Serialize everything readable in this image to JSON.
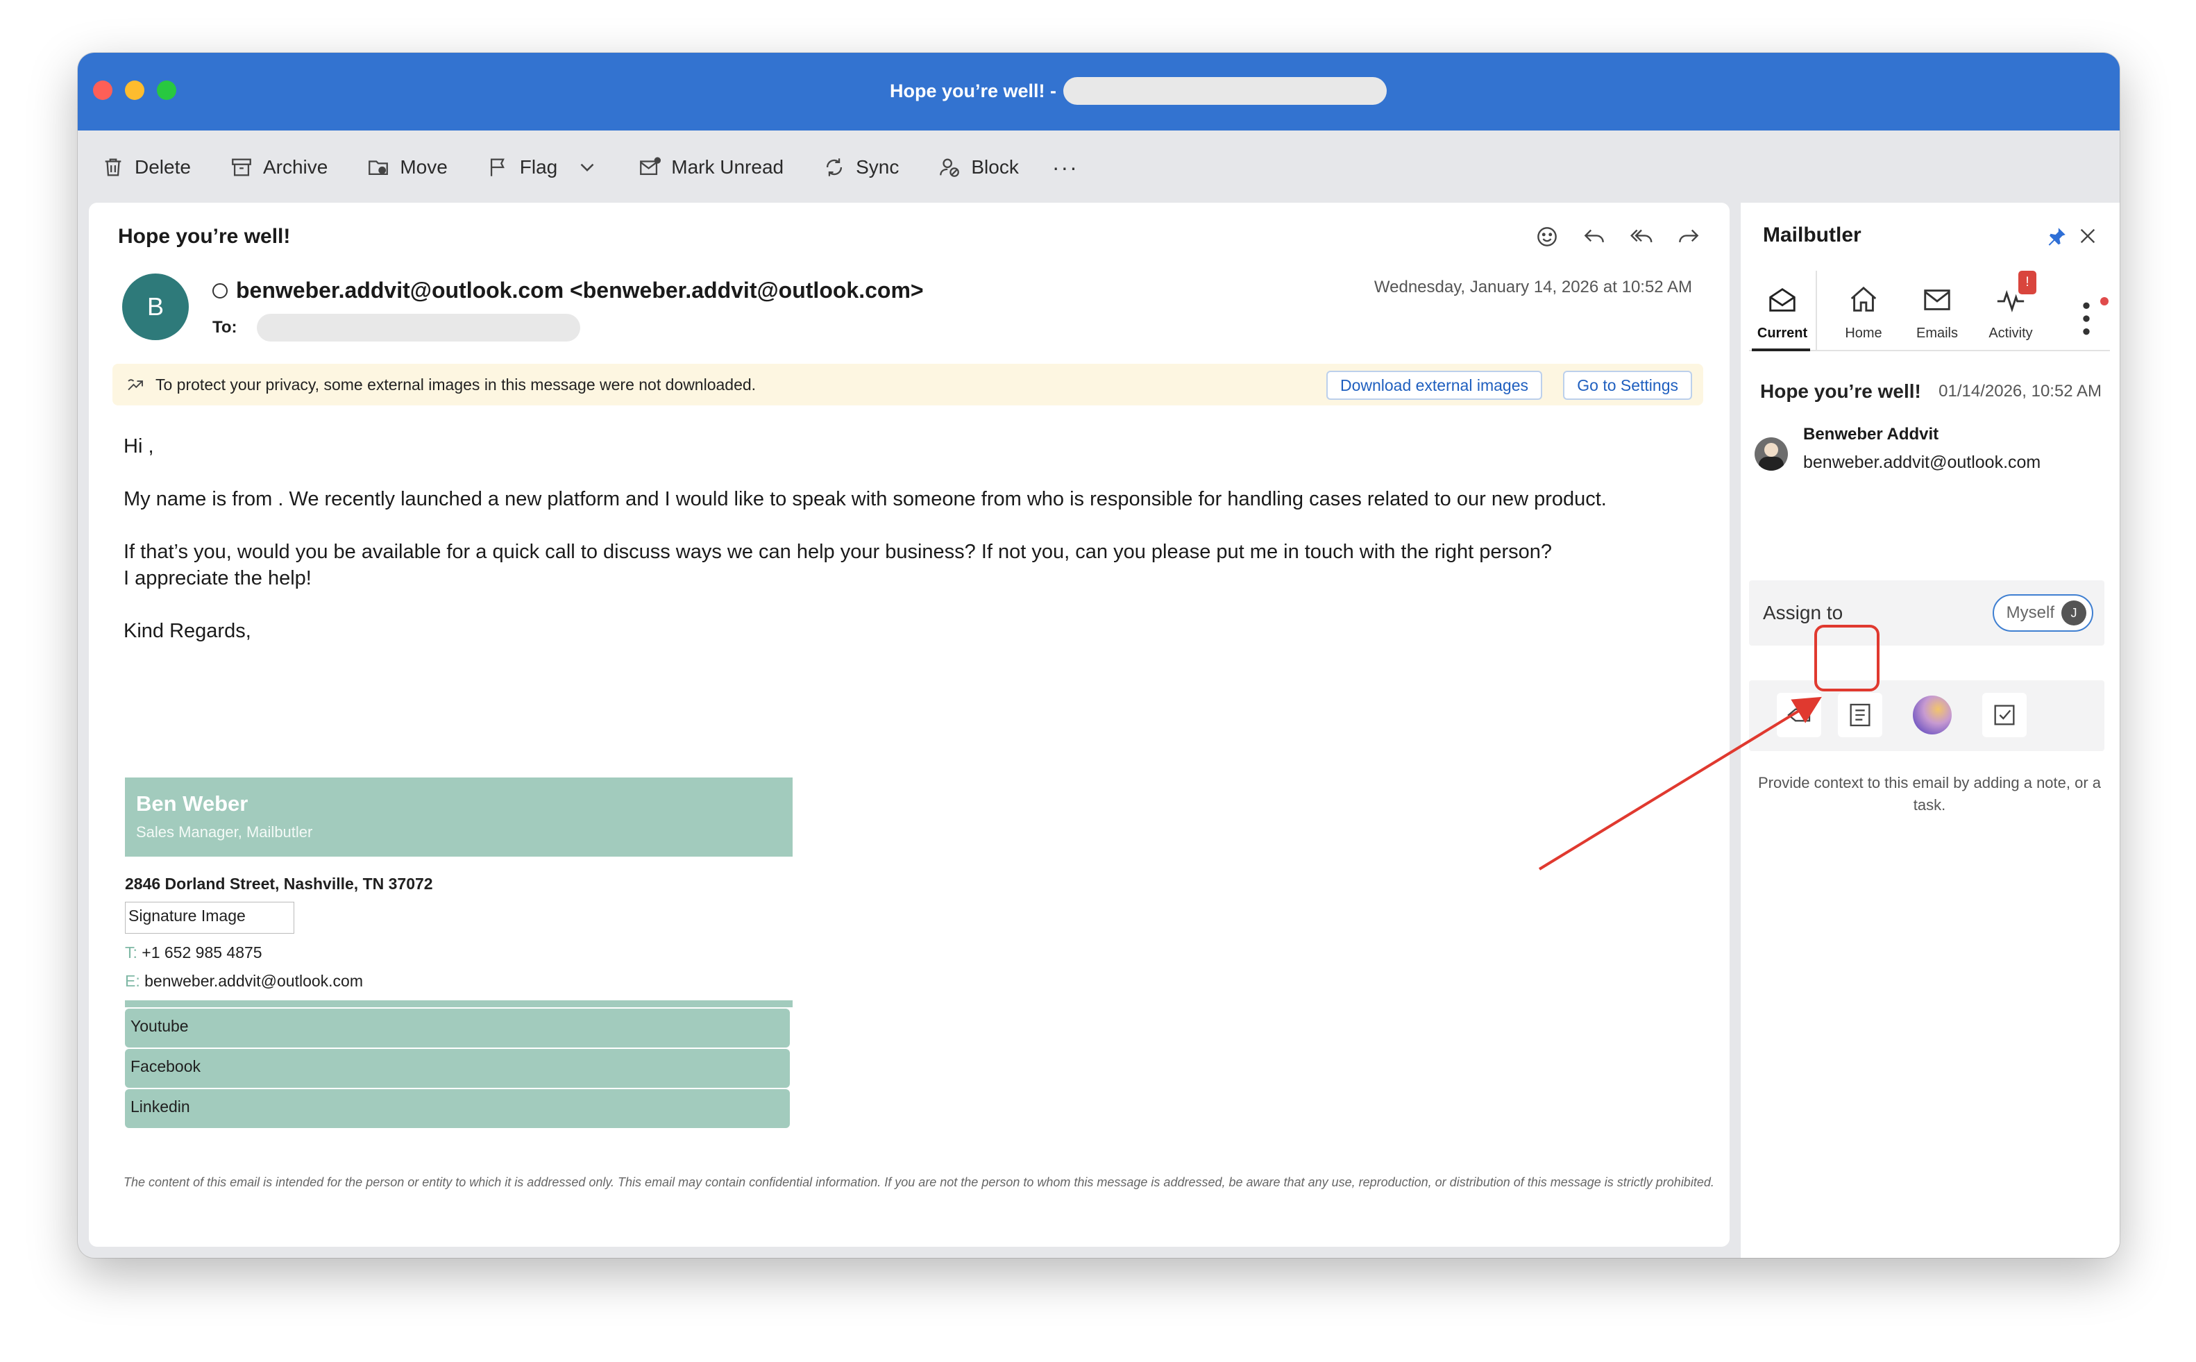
{
  "window": {
    "title": "Hope you’re well! -"
  },
  "toolbar": {
    "delete": "Delete",
    "archive": "Archive",
    "move": "Move",
    "flag": "Flag",
    "mark_unread": "Mark Unread",
    "sync": "Sync",
    "block": "Block",
    "more": "···"
  },
  "email": {
    "subject": "Hope you’re well!",
    "avatar_letter": "B",
    "from": "benweber.addvit@outlook.com <benweber.addvit@outlook.com>",
    "to_label": "To:",
    "datetime": "Wednesday, January 14, 2026 at 10:52 AM",
    "privacy_notice": "To protect your privacy, some external images in this message were not downloaded.",
    "download_images": "Download external images",
    "go_to_settings": "Go to Settings",
    "body": {
      "p1": "Hi ,",
      "p2": "My name is from . We recently launched a new platform and I would like to speak with someone from who is responsible for handling cases related to our new product.",
      "p3a": "If that’s you, would you be available for a quick call to discuss ways we can help your business? If not you, can you please put me in touch with the right person?",
      "p3b": "I appreciate the help!",
      "p4": "Kind Regards,"
    },
    "signature": {
      "name": "Ben Weber",
      "role": "Sales Manager, Mailbutler",
      "address": "2846 Dorland Street, Nashville, TN 37072",
      "image_alt": "Signature Image",
      "phone_label": "T:",
      "phone": "+1 652 985 4875",
      "email_label": "E:",
      "email": "benweber.addvit@outlook.com",
      "social": [
        "Youtube",
        "Facebook",
        "Linkedin"
      ]
    },
    "disclaimer": "The content of this email is intended for the person or entity to which it is addressed only. This email may contain confidential information. If you are not the person to whom this message is addressed, be aware that any use, reproduction, or distribution of this message is strictly prohibited."
  },
  "sidebar": {
    "title": "Mailbutler",
    "nav": {
      "current": "Current",
      "home": "Home",
      "emails": "Emails",
      "activity": "Activity",
      "activity_badge": "!"
    },
    "subject": "Hope you’re well!",
    "date": "01/14/2026, 10:52 AM",
    "contact_name": "Benweber Addvit",
    "contact_email": "benweber.addvit@outlook.com",
    "assign_label": "Assign to",
    "assign_value": "Myself",
    "assign_initial": "J",
    "help_text": "Provide context to this email by adding a note, or a task."
  },
  "colors": {
    "titlebar": "#3373d0",
    "accent": "#1f5fbf",
    "signature": "#a2cbbd",
    "highlight": "#e0392f"
  },
  "icons": [
    "trash-icon",
    "archive-icon",
    "folder-move-icon",
    "flag-icon",
    "chevron-down-icon",
    "mail-unread-icon",
    "sync-icon",
    "block-icon",
    "emoji-icon",
    "reply-icon",
    "reply-all-icon",
    "forward-icon",
    "pin-icon",
    "close-icon",
    "envelope-open-icon",
    "home-icon",
    "mail-icon",
    "activity-icon",
    "kebab-icon",
    "tag-icon",
    "note-icon",
    "ai-orb-icon",
    "task-check-icon"
  ]
}
